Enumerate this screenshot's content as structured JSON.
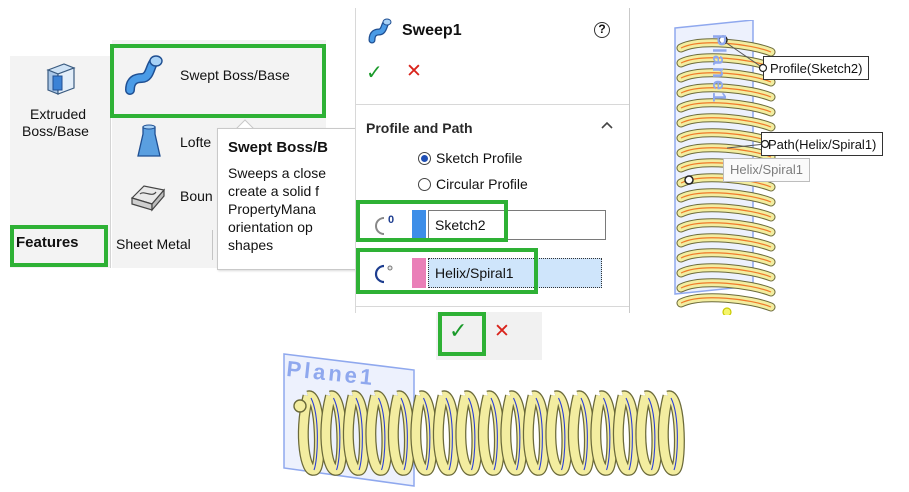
{
  "ribbon": {
    "extruded_label_line1": "Extruded",
    "extruded_label_line2": "Boss/Base",
    "features_tab": "Features",
    "sheet_metal_tab": "Sheet Metal",
    "swept_label": "Swept Boss/Base",
    "lofted_label": "Lofte",
    "boundary_label": "Boun"
  },
  "tooltip": {
    "title": "Swept Boss/B",
    "lines": [
      "Sweeps a close",
      "create a solid f",
      "PropertyMana",
      "orientation op",
      "shapes"
    ]
  },
  "property_manager": {
    "title": "Sweep1",
    "help_icon": "?",
    "ok_icon": "✓",
    "cancel_icon": "✕",
    "section_title": "Profile and Path",
    "radio_sketch_profile": "Sketch Profile",
    "radio_circular_profile": "Circular Profile",
    "profile_field_value": "Sketch2",
    "path_field_value": "Helix/Spiral1"
  },
  "bottom_buttons": {
    "ok_icon": "✓",
    "cancel_icon": "✕"
  },
  "graphics_right": {
    "plane_label": "Plane1",
    "callout_profile": "Profile(Sketch2)",
    "callout_path": "Path(Helix/Spiral1)",
    "hover_label": "Helix/Spiral1"
  },
  "graphics_bottom": {
    "plane_label": "Plane1"
  },
  "colors": {
    "highlight_green": "#2eb135",
    "check_green": "#1a9a2a",
    "cancel_red": "#d9231b",
    "spring_fill": "#f3eda0",
    "spring_outline": "#6b6a3a",
    "profile_swatch": "#3d8ee8",
    "path_swatch": "#ea7fb8",
    "path_field_bg": "#cfe5fb",
    "plane_blue": "#8fa8ee"
  }
}
